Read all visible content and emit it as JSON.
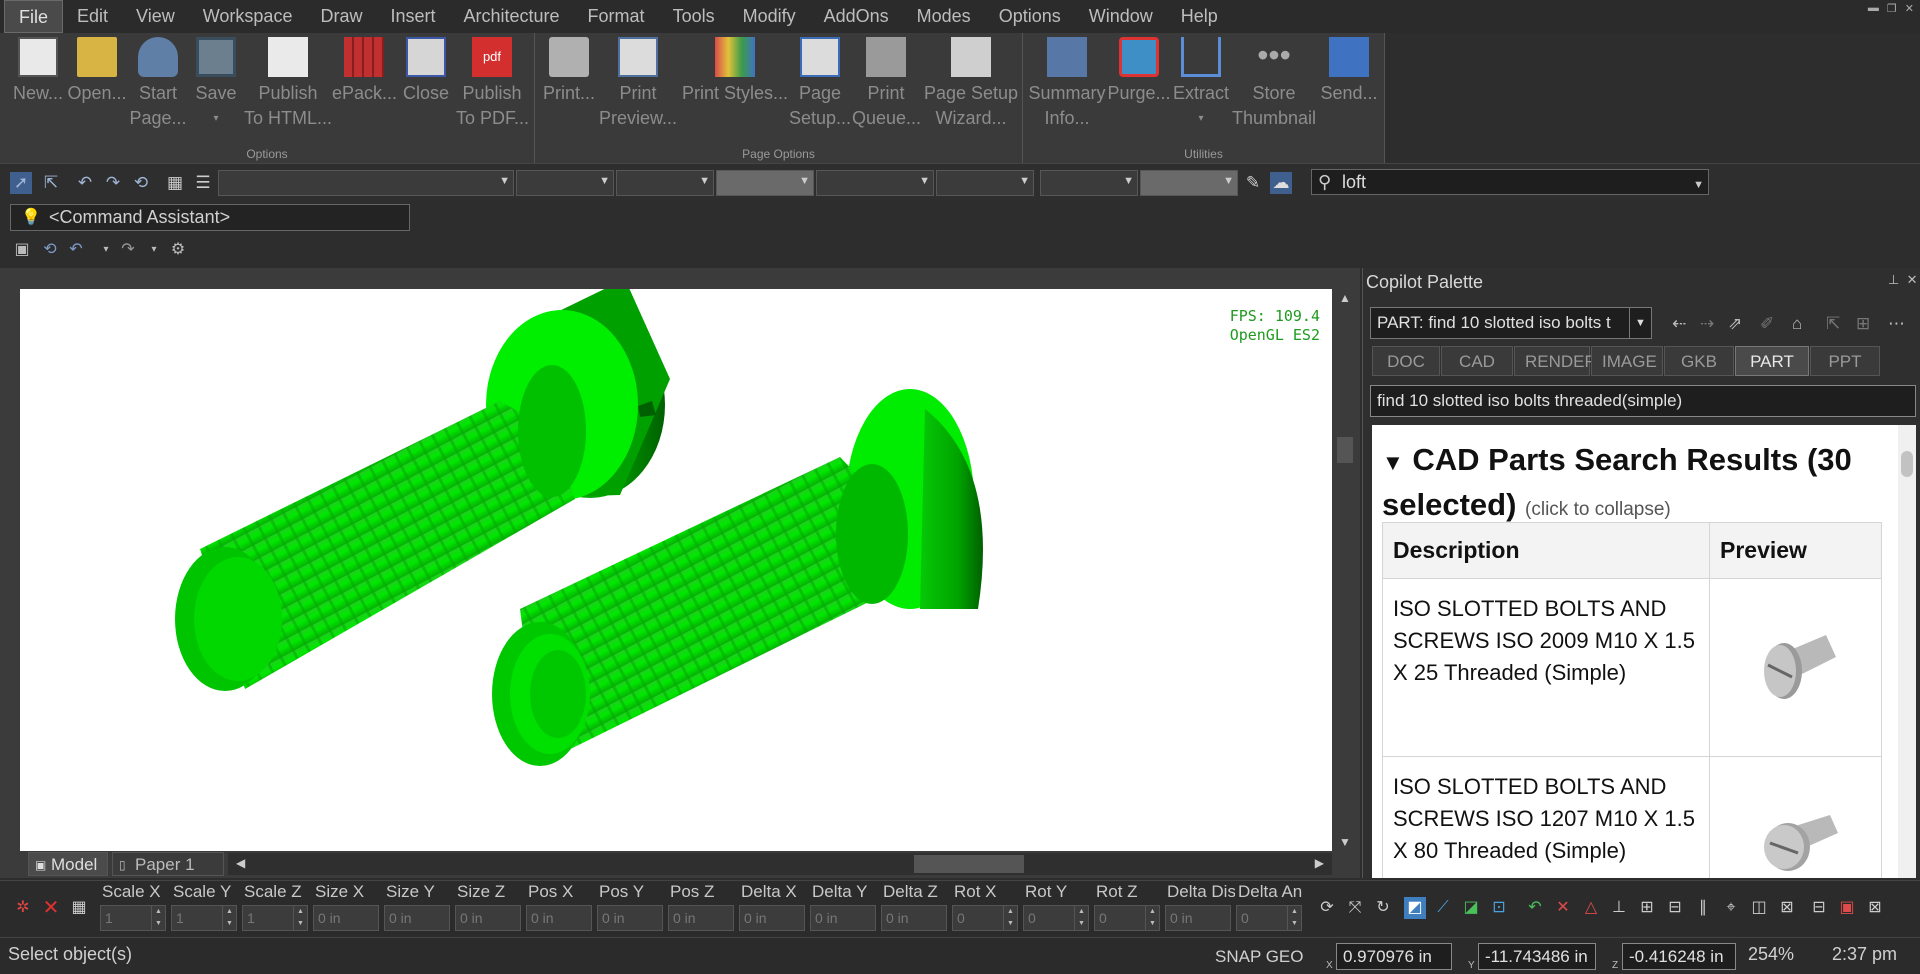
{
  "menu": [
    "File",
    "Edit",
    "View",
    "Workspace",
    "Draw",
    "Insert",
    "Architecture",
    "Format",
    "Tools",
    "Modify",
    "AddOns",
    "Modes",
    "Options",
    "Window",
    "Help"
  ],
  "ribbon": {
    "options_label": "Options",
    "page_options_label": "Page Options",
    "utilities_label": "Utilities",
    "buttons": [
      {
        "l1": "New...",
        "l2": ""
      },
      {
        "l1": "Open...",
        "l2": ""
      },
      {
        "l1": "Start",
        "l2": "Page..."
      },
      {
        "l1": "Save",
        "l2": "▾"
      },
      {
        "l1": "Publish",
        "l2": "To HTML..."
      },
      {
        "l1": "ePack...",
        "l2": ""
      },
      {
        "l1": "Close",
        "l2": ""
      },
      {
        "l1": "Publish",
        "l2": "To PDF..."
      },
      {
        "l1": "Print...",
        "l2": ""
      },
      {
        "l1": "Print",
        "l2": "Preview..."
      },
      {
        "l1": "Print Styles...",
        "l2": ""
      },
      {
        "l1": "Page",
        "l2": "Setup..."
      },
      {
        "l1": "Print",
        "l2": "Queue..."
      },
      {
        "l1": "Page Setup",
        "l2": "Wizard..."
      },
      {
        "l1": "Summary",
        "l2": "Info..."
      },
      {
        "l1": "Purge...",
        "l2": ""
      },
      {
        "l1": "Extract",
        "l2": "▾"
      },
      {
        "l1": "Store",
        "l2": "Thumbnail"
      },
      {
        "l1": "Send...",
        "l2": ""
      }
    ]
  },
  "search": {
    "value": "loft"
  },
  "command_assistant": "<Command Assistant>",
  "viewport": {
    "fps": "FPS: 109.4",
    "renderer": "OpenGL ES2"
  },
  "view_tabs": [
    "Model",
    "Paper 1"
  ],
  "palette": {
    "title": "Copilot Palette",
    "query": "PART: find 10 slotted iso bolts t",
    "tabs": [
      "DOC",
      "CAD",
      "RENDER",
      "IMAGE",
      "GKB",
      "PART",
      "PPT"
    ],
    "active_tab": "PART",
    "field": "find 10 slotted iso bolts threaded(simple)",
    "results_title": "CAD Parts Search Results (30 selected)",
    "results_hint": "(click to collapse)",
    "columns": [
      "Description",
      "Preview"
    ],
    "rows": [
      {
        "desc": "ISO SLOTTED BOLTS AND SCREWS ISO 2009 M10 X 1.5 X 25 Threaded (Simple)"
      },
      {
        "desc": "ISO SLOTTED BOLTS AND SCREWS ISO 1207 M10 X 1.5 X 80 Threaded (Simple)"
      }
    ]
  },
  "properties": [
    {
      "label": "Scale X",
      "value": "1"
    },
    {
      "label": "Scale Y",
      "value": "1"
    },
    {
      "label": "Scale Z",
      "value": "1"
    },
    {
      "label": "Size X",
      "value": "0 in"
    },
    {
      "label": "Size Y",
      "value": "0 in"
    },
    {
      "label": "Size Z",
      "value": "0 in"
    },
    {
      "label": "Pos X",
      "value": "0 in"
    },
    {
      "label": "Pos Y",
      "value": "0 in"
    },
    {
      "label": "Pos Z",
      "value": "0 in"
    },
    {
      "label": "Delta X",
      "value": "0 in"
    },
    {
      "label": "Delta Y",
      "value": "0 in"
    },
    {
      "label": "Delta Z",
      "value": "0 in"
    },
    {
      "label": "Rot X",
      "value": "0"
    },
    {
      "label": "Rot Y",
      "value": "0"
    },
    {
      "label": "Rot Z",
      "value": "0"
    },
    {
      "label": "Delta Dis",
      "value": "0 in"
    },
    {
      "label": "Delta An",
      "value": "0"
    }
  ],
  "status": {
    "message": "Select object(s)",
    "snap": "SNAP GEO",
    "x": "0.970976 in",
    "y": "-11.743486 in",
    "z": "-0.416248 in",
    "zoom": "254%",
    "time": "2:37 pm"
  },
  "colors": {
    "part_green": "#00e000",
    "fps_green": "#1f9a1f",
    "ui_dark": "#2d2d2d"
  }
}
